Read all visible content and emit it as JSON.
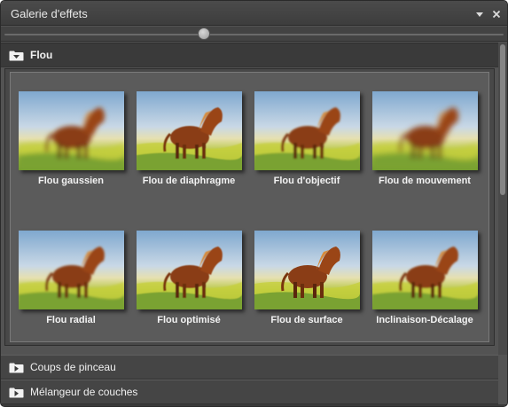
{
  "panel": {
    "title": "Galerie d'effets",
    "menu_icon": "dropdown-arrow-icon",
    "close_icon": "close-icon",
    "thumbnail_size": 0.4
  },
  "sections": [
    {
      "label": "Flou",
      "expanded": true,
      "effects": [
        {
          "label": "Flou gaussien",
          "blur": 2.6
        },
        {
          "label": "Flou de diaphragme",
          "blur": 0.4
        },
        {
          "label": "Flou d'objectif",
          "blur": 1.0
        },
        {
          "label": "Flou de mouvement",
          "blur": 3.2
        },
        {
          "label": "Flou radial",
          "blur": 1.2
        },
        {
          "label": "Flou optimisé",
          "blur": 0.6
        },
        {
          "label": "Flou de surface",
          "blur": 0.3
        },
        {
          "label": "Inclinaison-Décalage",
          "blur": 1.0
        }
      ]
    },
    {
      "label": "Coups de pinceau",
      "expanded": false
    },
    {
      "label": "Mélangeur de couches",
      "expanded": false
    }
  ],
  "colors": {
    "panel_bg": "#535353",
    "header_bg": "#3a3a3a",
    "text": "#f0f0f0"
  }
}
